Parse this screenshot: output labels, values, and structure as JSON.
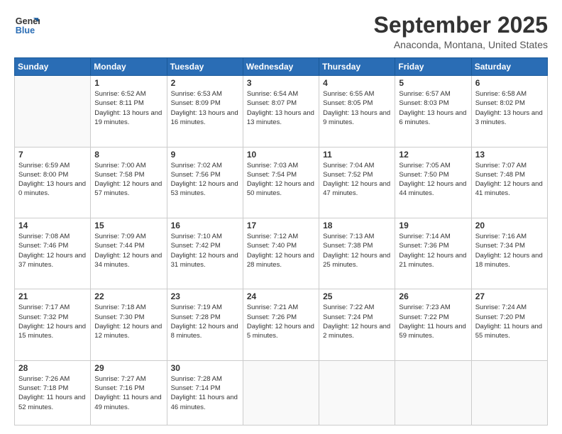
{
  "logo": {
    "line1": "General",
    "line2": "Blue"
  },
  "header": {
    "month": "September 2025",
    "location": "Anaconda, Montana, United States"
  },
  "weekdays": [
    "Sunday",
    "Monday",
    "Tuesday",
    "Wednesday",
    "Thursday",
    "Friday",
    "Saturday"
  ],
  "weeks": [
    [
      {
        "day": null
      },
      {
        "day": "1",
        "sunrise": "6:52 AM",
        "sunset": "8:11 PM",
        "daylight": "13 hours and 19 minutes."
      },
      {
        "day": "2",
        "sunrise": "6:53 AM",
        "sunset": "8:09 PM",
        "daylight": "13 hours and 16 minutes."
      },
      {
        "day": "3",
        "sunrise": "6:54 AM",
        "sunset": "8:07 PM",
        "daylight": "13 hours and 13 minutes."
      },
      {
        "day": "4",
        "sunrise": "6:55 AM",
        "sunset": "8:05 PM",
        "daylight": "13 hours and 9 minutes."
      },
      {
        "day": "5",
        "sunrise": "6:57 AM",
        "sunset": "8:03 PM",
        "daylight": "13 hours and 6 minutes."
      },
      {
        "day": "6",
        "sunrise": "6:58 AM",
        "sunset": "8:02 PM",
        "daylight": "13 hours and 3 minutes."
      }
    ],
    [
      {
        "day": "7",
        "sunrise": "6:59 AM",
        "sunset": "8:00 PM",
        "daylight": "13 hours and 0 minutes."
      },
      {
        "day": "8",
        "sunrise": "7:00 AM",
        "sunset": "7:58 PM",
        "daylight": "12 hours and 57 minutes."
      },
      {
        "day": "9",
        "sunrise": "7:02 AM",
        "sunset": "7:56 PM",
        "daylight": "12 hours and 53 minutes."
      },
      {
        "day": "10",
        "sunrise": "7:03 AM",
        "sunset": "7:54 PM",
        "daylight": "12 hours and 50 minutes."
      },
      {
        "day": "11",
        "sunrise": "7:04 AM",
        "sunset": "7:52 PM",
        "daylight": "12 hours and 47 minutes."
      },
      {
        "day": "12",
        "sunrise": "7:05 AM",
        "sunset": "7:50 PM",
        "daylight": "12 hours and 44 minutes."
      },
      {
        "day": "13",
        "sunrise": "7:07 AM",
        "sunset": "7:48 PM",
        "daylight": "12 hours and 41 minutes."
      }
    ],
    [
      {
        "day": "14",
        "sunrise": "7:08 AM",
        "sunset": "7:46 PM",
        "daylight": "12 hours and 37 minutes."
      },
      {
        "day": "15",
        "sunrise": "7:09 AM",
        "sunset": "7:44 PM",
        "daylight": "12 hours and 34 minutes."
      },
      {
        "day": "16",
        "sunrise": "7:10 AM",
        "sunset": "7:42 PM",
        "daylight": "12 hours and 31 minutes."
      },
      {
        "day": "17",
        "sunrise": "7:12 AM",
        "sunset": "7:40 PM",
        "daylight": "12 hours and 28 minutes."
      },
      {
        "day": "18",
        "sunrise": "7:13 AM",
        "sunset": "7:38 PM",
        "daylight": "12 hours and 25 minutes."
      },
      {
        "day": "19",
        "sunrise": "7:14 AM",
        "sunset": "7:36 PM",
        "daylight": "12 hours and 21 minutes."
      },
      {
        "day": "20",
        "sunrise": "7:16 AM",
        "sunset": "7:34 PM",
        "daylight": "12 hours and 18 minutes."
      }
    ],
    [
      {
        "day": "21",
        "sunrise": "7:17 AM",
        "sunset": "7:32 PM",
        "daylight": "12 hours and 15 minutes."
      },
      {
        "day": "22",
        "sunrise": "7:18 AM",
        "sunset": "7:30 PM",
        "daylight": "12 hours and 12 minutes."
      },
      {
        "day": "23",
        "sunrise": "7:19 AM",
        "sunset": "7:28 PM",
        "daylight": "12 hours and 8 minutes."
      },
      {
        "day": "24",
        "sunrise": "7:21 AM",
        "sunset": "7:26 PM",
        "daylight": "12 hours and 5 minutes."
      },
      {
        "day": "25",
        "sunrise": "7:22 AM",
        "sunset": "7:24 PM",
        "daylight": "12 hours and 2 minutes."
      },
      {
        "day": "26",
        "sunrise": "7:23 AM",
        "sunset": "7:22 PM",
        "daylight": "11 hours and 59 minutes."
      },
      {
        "day": "27",
        "sunrise": "7:24 AM",
        "sunset": "7:20 PM",
        "daylight": "11 hours and 55 minutes."
      }
    ],
    [
      {
        "day": "28",
        "sunrise": "7:26 AM",
        "sunset": "7:18 PM",
        "daylight": "11 hours and 52 minutes."
      },
      {
        "day": "29",
        "sunrise": "7:27 AM",
        "sunset": "7:16 PM",
        "daylight": "11 hours and 49 minutes."
      },
      {
        "day": "30",
        "sunrise": "7:28 AM",
        "sunset": "7:14 PM",
        "daylight": "11 hours and 46 minutes."
      },
      {
        "day": null
      },
      {
        "day": null
      },
      {
        "day": null
      },
      {
        "day": null
      }
    ]
  ]
}
